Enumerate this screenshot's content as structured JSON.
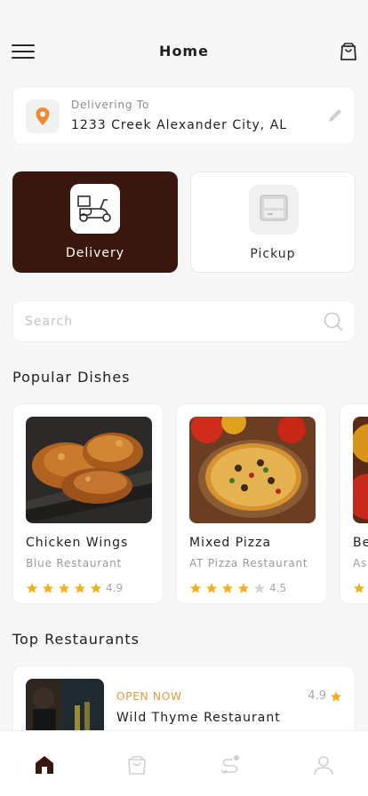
{
  "header": {
    "title": "Home",
    "menu_icon": "hamburger-menu-icon",
    "cart_icon": "shopping-bag-icon"
  },
  "address": {
    "label": "Delivering To",
    "value": "1233 Creek Alexander City, AL",
    "pin_icon": "location-pin-icon",
    "edit_icon": "pencil-icon"
  },
  "modes": [
    {
      "label": "Delivery",
      "icon": "scooter-icon",
      "selected": true
    },
    {
      "label": "Pickup",
      "icon": "pickup-box-icon",
      "selected": false
    }
  ],
  "search": {
    "placeholder": "Search",
    "icon": "search-icon"
  },
  "popular": {
    "title": "Popular Dishes",
    "items": [
      {
        "name": "Chicken Wings",
        "restaurant": "Blue Restaurant",
        "rating": "4.9",
        "stars": 5
      },
      {
        "name": "Mixed Pizza",
        "restaurant": "AT Pizza Restaurant",
        "rating": "4.5",
        "stars": 4
      },
      {
        "name": "Be",
        "restaurant": "Asi",
        "rating": "",
        "stars": 1
      }
    ]
  },
  "top": {
    "title": "Top Restaurants",
    "items": [
      {
        "status": "OPEN NOW",
        "name": "Wild Thyme Restaurant",
        "rating": "4.9"
      }
    ]
  },
  "tabs": [
    {
      "icon": "home-icon",
      "active": true
    },
    {
      "icon": "shopping-bag-icon",
      "active": false
    },
    {
      "icon": "route-icon",
      "active": false
    },
    {
      "icon": "profile-icon",
      "active": false
    }
  ],
  "colors": {
    "brand": "#3a170e",
    "star": "#f2b01e",
    "accent": "#e39a37",
    "pin": "#ef8a35"
  }
}
